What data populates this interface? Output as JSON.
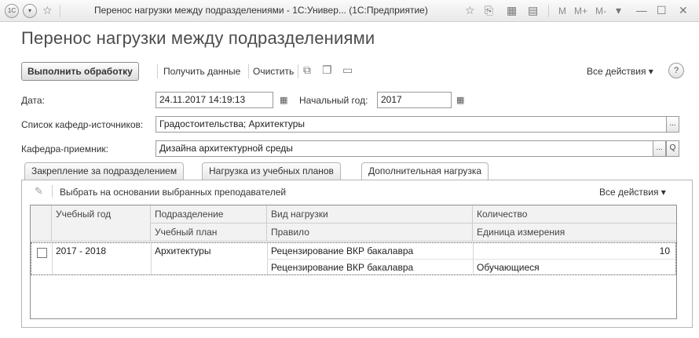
{
  "window": {
    "title": "Перенос нагрузки между подразделениями - 1С:Универ... (1С:Предприятие)",
    "m_buttons": [
      "M",
      "M+",
      "M-"
    ]
  },
  "form": {
    "title": "Перенос нагрузки между подразделениями"
  },
  "commands": {
    "execute": "Выполнить обработку",
    "get_data": "Получить данные",
    "clear": "Очистить",
    "all_actions": "Все действия ▾",
    "help": "?"
  },
  "fields": {
    "date_label": "Дата:",
    "date_value": "24.11.2017 14:19:13",
    "start_year_label": "Начальный год:",
    "start_year_value": "2017",
    "source_depts_label": "Список кафедр-источников:",
    "source_depts_value": "Градостоительства; Архитектуры",
    "target_dept_label": "Кафедра-приемник:",
    "target_dept_value": "Дизайна архитектурной среды",
    "ellipsis": "...",
    "search": "Q"
  },
  "tabs": [
    {
      "label": "Закрепление за подразделением"
    },
    {
      "label": "Нагрузка из учебных планов"
    },
    {
      "label": "Дополнительная нагрузка"
    }
  ],
  "table_toolbar": {
    "select_label": "Выбрать на основании выбранных преподавателей",
    "all_actions": "Все действия ▾"
  },
  "grid": {
    "header_row1": [
      "Учебный год",
      "Подразделение",
      "Вид нагрузки",
      "Количество"
    ],
    "header_row2": [
      "Учебный план",
      "Правило",
      "Единица измерения"
    ],
    "rows": [
      {
        "year": "2017 - 2018",
        "department": "Архитектуры",
        "load_type": "Рецензирование ВКР бакалавра",
        "quantity": "10",
        "plan": "",
        "rule": "Рецензирование ВКР бакалавра",
        "unit": "Обучающиеся"
      }
    ]
  },
  "colors": {
    "header_bg": "#f2f2f2",
    "border": "#9a9a9a",
    "title_text": "#4c4c4c"
  }
}
